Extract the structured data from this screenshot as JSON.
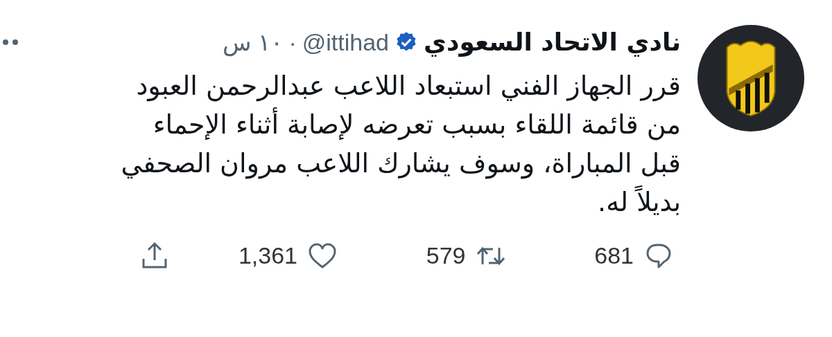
{
  "author": {
    "name": "نادي الاتحاد السعودي",
    "verified": true,
    "handle": "@ittihad",
    "separator": "·",
    "time": "١٠ س"
  },
  "tweet": {
    "lines": [
      "قرر الجهاز الفني استبعاد اللاعب عبدالرحمن العبود",
      "من قائمة اللقاء بسبب تعرضه لإصابة أثناء الإحماء",
      "قبل المباراة، وسوف يشارك اللاعب مروان الصحفي",
      "بديلاً له."
    ]
  },
  "actions": [
    {
      "kind": "reply",
      "count": "681"
    },
    {
      "kind": "retweet",
      "count": "579"
    },
    {
      "kind": "like",
      "count": "1,361"
    },
    {
      "kind": "share"
    }
  ]
}
